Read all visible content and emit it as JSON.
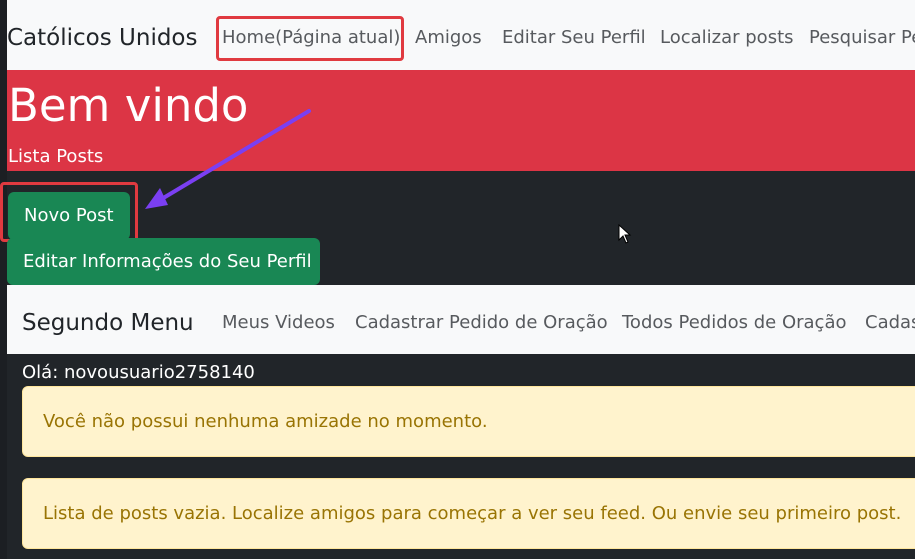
{
  "navbar": {
    "brand": "Católicos Unidos",
    "links": [
      {
        "label": "Home(Página atual)"
      },
      {
        "label": "Amigos"
      },
      {
        "label": "Editar Seu Perfil"
      },
      {
        "label": "Localizar posts"
      },
      {
        "label": "Pesquisar Pe"
      }
    ]
  },
  "jumbotron": {
    "title": "Bem vindo",
    "subtitle": "Lista Posts"
  },
  "buttons": {
    "new_post": "Novo Post",
    "edit_profile": "Editar Informações do Seu Perfil"
  },
  "second_menu": {
    "brand": "Segundo Menu",
    "links": [
      {
        "label": "Meus Videos"
      },
      {
        "label": "Cadastrar Pedido de Oração"
      },
      {
        "label": "Todos Pedidos de Oração"
      },
      {
        "label": "Cadas"
      }
    ]
  },
  "greeting": "Olá: novousuario2758140",
  "alerts": [
    {
      "text": "Você não possui nenhuma amizade no momento."
    },
    {
      "text": "Lista de posts vazia. Localize amigos para começar a ver seu feed. Ou envie seu primeiro post."
    }
  ],
  "colors": {
    "navbar_bg": "#f8f9fa",
    "jumbotron_bg": "#dc3545",
    "button_green": "#198754",
    "page_bg": "#212529",
    "alert_bg": "#fff3cd",
    "alert_text": "#997404",
    "annotation_red": "#e03a40",
    "annotation_arrow": "#7b3ff2"
  },
  "icons": {
    "cursor": "mouse-pointer-icon",
    "arrow": "annotation-arrow-icon"
  }
}
